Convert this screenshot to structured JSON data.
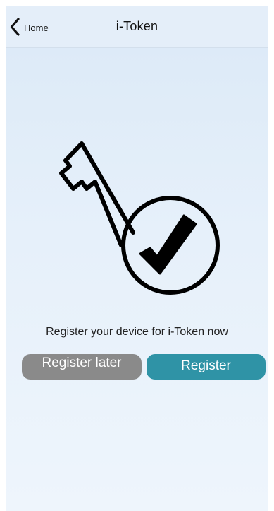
{
  "header": {
    "back_label": "Home",
    "title": "i-Token"
  },
  "hero": {
    "icon": "key-check-icon"
  },
  "main": {
    "prompt": "Register your device for i-Token now",
    "later_button_label": "Register later",
    "register_button_label": "Register"
  },
  "colors": {
    "background": "#e6f0fa",
    "register_button": "#2f93a6",
    "later_button": "#8a8a8a"
  }
}
